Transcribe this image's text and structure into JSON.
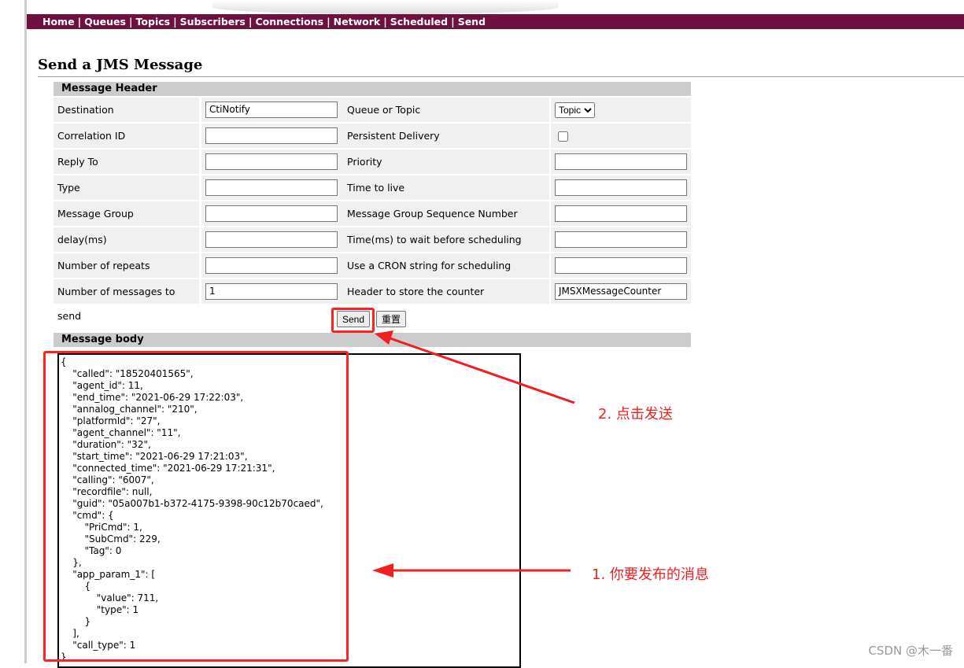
{
  "nav": [
    "Home",
    "Queues",
    "Topics",
    "Subscribers",
    "Connections",
    "Network",
    "Scheduled",
    "Send"
  ],
  "title": "Send a JMS Message",
  "header_section": "Message Header",
  "rows": [
    {
      "l1": "Destination",
      "v1": "CtiNotify",
      "l2": "Queue or Topic",
      "type2": "select",
      "v2": "Topic"
    },
    {
      "l1": "Correlation ID",
      "v1": "",
      "l2": "Persistent Delivery",
      "type2": "checkbox",
      "checked": false
    },
    {
      "l1": "Reply To",
      "v1": "",
      "l2": "Priority",
      "v2": ""
    },
    {
      "l1": "Type",
      "v1": "",
      "l2": "Time to live",
      "v2": ""
    },
    {
      "l1": "Message Group",
      "v1": "",
      "l2": "Message Group Sequence Number",
      "v2": ""
    },
    {
      "l1": "delay(ms)",
      "v1": "",
      "l2": "Time(ms) to wait before scheduling again",
      "v2": ""
    },
    {
      "l1": "Number of repeats",
      "v1": "",
      "l2": "Use a CRON string for scheduling",
      "v2": ""
    },
    {
      "l1": "Number of messages to send",
      "v1": "1",
      "l2": "Header to store the counter",
      "v2": "JMSXMessageCounter"
    }
  ],
  "buttons": {
    "send": "Send",
    "reset": "重置"
  },
  "body_section": "Message body",
  "body_text": "{\n    \"called\": \"18520401565\",\n    \"agent_id\": 11,\n    \"end_time\": \"2021-06-29 17:22:03\",\n    \"annalog_channel\": \"210\",\n    \"platformId\": \"27\",\n    \"agent_channel\": \"11\",\n    \"duration\": \"32\",\n    \"start_time\": \"2021-06-29 17:21:03\",\n    \"connected_time\": \"2021-06-29 17:21:31\",\n    \"calling\": \"6007\",\n    \"recordfile\": null,\n    \"guid\": \"05a007b1-b372-4175-9398-90c12b70caed\",\n    \"cmd\": {\n        \"PriCmd\": 1,\n        \"SubCmd\": 229,\n        \"Tag\": 0\n    },\n    \"app_param_1\": [\n        {\n            \"value\": 711,\n            \"type\": 1\n        }\n    ],\n    \"call_type\": 1\n}",
  "annotations": {
    "send": "2. 点击发送",
    "message": "1. 你要发布的消息"
  },
  "watermark": "CSDN @木一番",
  "colors": {
    "nav": "#6e1040",
    "annotation": "#f02020"
  }
}
